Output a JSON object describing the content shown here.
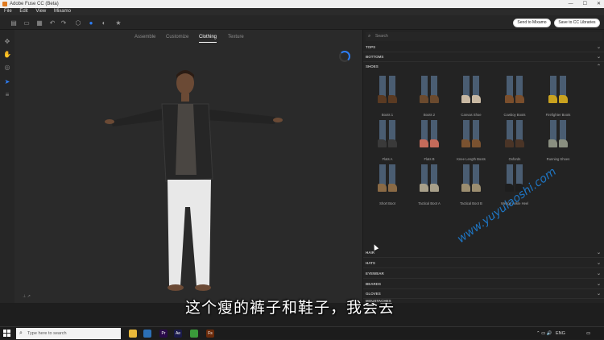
{
  "app": {
    "title": "Adobe Fuse CC (Beta)"
  },
  "menu": [
    "File",
    "Edit",
    "View",
    "Mixamo"
  ],
  "toolbar": {
    "icons": [
      "folder-plus-icon",
      "open-icon",
      "image-icon",
      "save-icon",
      "undo-icon",
      "redo-icon",
      "cube-icon",
      "sphere-icon",
      "star-icon"
    ],
    "send_mixamo": "Send to Mixamo",
    "save_cc": "Save to CC Libraries"
  },
  "viewport": {
    "tabs": [
      "Assemble",
      "Customize",
      "Clothing",
      "Texture"
    ],
    "active_tab": "Clothing",
    "subtitle": "这个瘦的裤子和鞋子，我会去"
  },
  "panel": {
    "search_placeholder": "Search",
    "categories_top": [
      "TOPS",
      "BOTTOMS"
    ],
    "active_category": "SHOES",
    "shoes": [
      {
        "label": "Boots 1",
        "color": "#5a3a22"
      },
      {
        "label": "Boots 2",
        "color": "#6b4a2e"
      },
      {
        "label": "Canvas Shoe",
        "color": "#c9b9a3"
      },
      {
        "label": "Cowboy Boots",
        "color": "#7a4e2c"
      },
      {
        "label": "Firefighter Boots",
        "color": "#c9a21f"
      },
      {
        "label": "Flats A",
        "color": "#3a3a3a"
      },
      {
        "label": "Flats B",
        "color": "#c46b5a"
      },
      {
        "label": "Knee Length Boots",
        "color": "#7a5230"
      },
      {
        "label": "Oxfords",
        "color": "#4a3426"
      },
      {
        "label": "Running Shoes",
        "color": "#8a8f80"
      },
      {
        "label": "Short Boot",
        "color": "#8a6a45"
      },
      {
        "label": "Tactical Boot A",
        "color": "#a8a08a"
      },
      {
        "label": "Tactical Boot B",
        "color": "#9c8e70"
      },
      {
        "label": "Wedge Ankle Heel",
        "color": "#1e1e1e"
      }
    ],
    "categories_bottom": [
      "HAIR",
      "HATS",
      "EYEWEAR",
      "BEARDS",
      "GLOVES",
      "MOUSTACHES"
    ]
  },
  "watermark": "www.yuyulaoshi.com",
  "taskbar": {
    "search_placeholder": "Type here to search",
    "apps": [
      {
        "name": "file-explorer-icon",
        "color": "#e8b83a",
        "label": ""
      },
      {
        "name": "edge-icon",
        "color": "#2b6fb6",
        "label": ""
      },
      {
        "name": "premiere-icon",
        "color": "#2a0a4a",
        "label": "Pr"
      },
      {
        "name": "after-effects-icon",
        "color": "#1a1a4a",
        "label": "Ae"
      },
      {
        "name": "chrome-icon",
        "color": "#3a9a3a",
        "label": ""
      },
      {
        "name": "fuse-icon",
        "color": "#6a2a0a",
        "label": "Fs"
      }
    ],
    "language": "ENG"
  }
}
